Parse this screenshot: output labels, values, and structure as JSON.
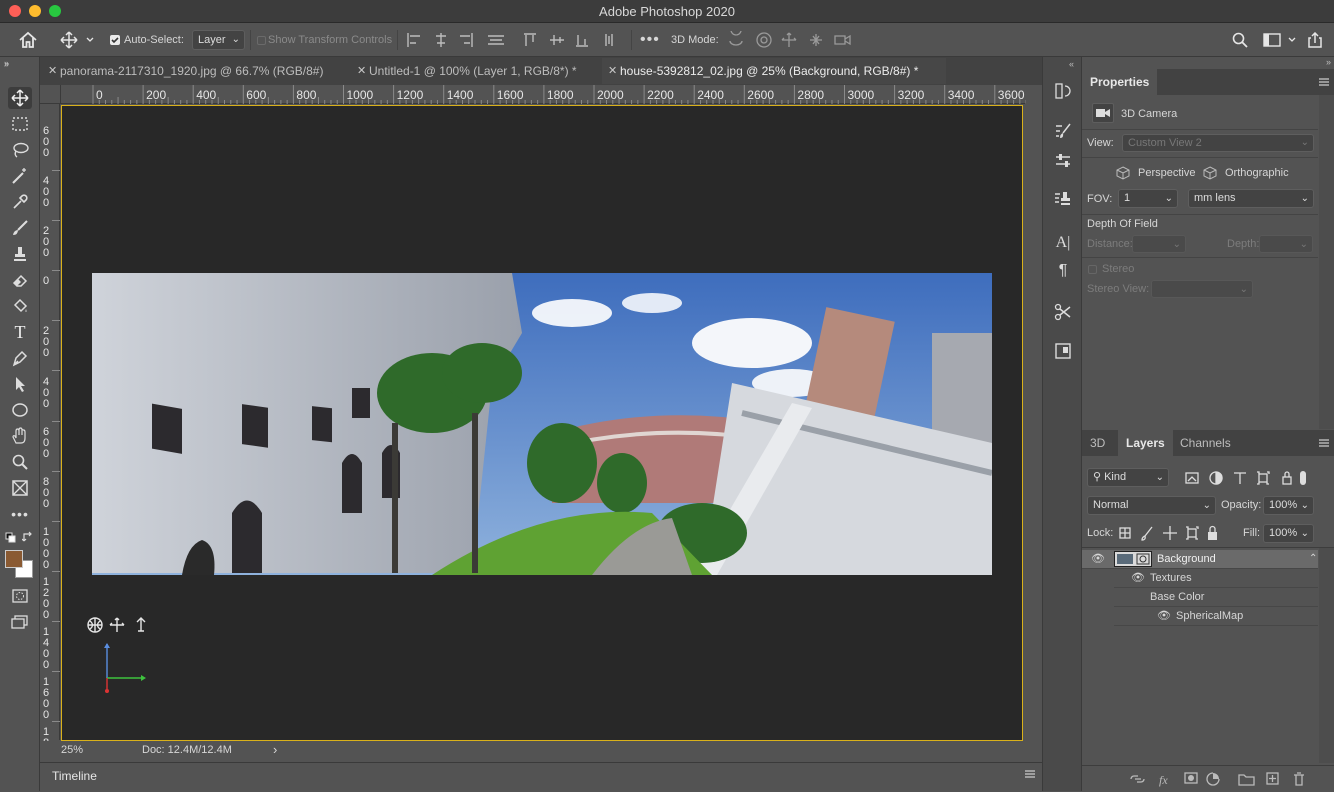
{
  "window": {
    "title": "Adobe Photoshop 2020"
  },
  "options_bar": {
    "auto_select_label": "Auto-Select:",
    "auto_select_value": "Layer",
    "show_transform_label": "Show Transform Controls",
    "three_d_mode_label": "3D Mode:"
  },
  "tabs": [
    {
      "label": "panorama-2117310_1920.jpg @ 66.7% (RGB/8#)"
    },
    {
      "label": "Untitled-1 @ 100% (Layer 1, RGB/8*) *"
    },
    {
      "label": "house-5392812_02.jpg @ 25% (Background, RGB/8#) *"
    }
  ],
  "ruler_h": [
    "0",
    "200",
    "400",
    "600",
    "800",
    "1000",
    "1200",
    "1400",
    "1600",
    "1800",
    "2000",
    "2200",
    "2400",
    "2600",
    "2800",
    "3000",
    "3200",
    "3400",
    "3600"
  ],
  "ruler_v": [
    "6\n0\n0",
    "4\n0\n0",
    "2\n0\n0",
    "0",
    "2\n0\n0",
    "4\n0\n0",
    "6\n0\n0",
    "8\n0\n0",
    "1\n0\n0\n0",
    "1\n2\n0\n0",
    "1\n4\n0\n0",
    "1\n6\n0\n0",
    "1\n8"
  ],
  "status": {
    "zoom": "25%",
    "doc": "Doc: 12.4M/12.4M"
  },
  "timeline": {
    "label": "Timeline"
  },
  "properties": {
    "title": "Properties",
    "camera_label": "3D Camera",
    "view_label": "View:",
    "view_value": "Custom View 2",
    "perspective_label": "Perspective",
    "orthographic_label": "Orthographic",
    "fov_label": "FOV:",
    "fov_value": "1",
    "lens_value": "mm lens",
    "dof_label": "Depth Of Field",
    "distance_label": "Distance:",
    "depth_label": "Depth:",
    "stereo_label": "Stereo",
    "stereo_view_label": "Stereo View:"
  },
  "layers_panel": {
    "tabs": [
      "3D",
      "Layers",
      "Channels"
    ],
    "kind_label": "Kind",
    "blend_mode": "Normal",
    "opacity_label": "Opacity:",
    "opacity_value": "100%",
    "lock_label": "Lock:",
    "fill_label": "Fill:",
    "fill_value": "100%",
    "rows": [
      {
        "name": "Background"
      },
      {
        "name": "Textures"
      },
      {
        "name": "Base Color"
      },
      {
        "name": "SphericalMap"
      }
    ]
  },
  "colors": {
    "accent_border": "#d9b11a",
    "foreground": "#8a5a32",
    "background": "#ffffff"
  }
}
